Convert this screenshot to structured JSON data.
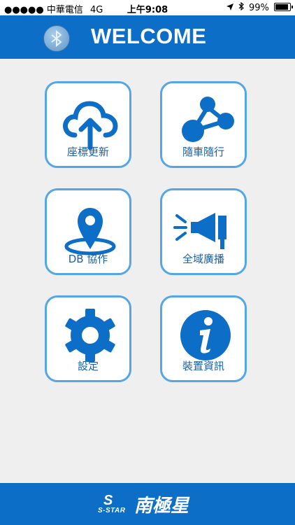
{
  "status_bar": {
    "carrier": "●●●●● 中華電信",
    "network": "4G",
    "time": "上午9:08",
    "location_icon": "location-arrow-icon",
    "bluetooth_icon": "bluetooth-icon",
    "battery": "99%"
  },
  "header": {
    "title": "WELCOME",
    "bluetooth_button_icon": "bluetooth-icon"
  },
  "tiles": [
    {
      "label": "座標更新",
      "icon": "cloud-upload-icon"
    },
    {
      "label": "隨車隨行",
      "icon": "share-nodes-icon"
    },
    {
      "label": "DB 協作",
      "icon": "map-pin-icon"
    },
    {
      "label": "全域廣播",
      "icon": "megaphone-icon"
    },
    {
      "label": "設定",
      "icon": "gear-icon"
    },
    {
      "label": "裝置資訊",
      "icon": "info-icon"
    }
  ],
  "footer": {
    "brand_mark": "S",
    "brand_en": "S-STAR",
    "brand_cn": "南極星"
  },
  "colors": {
    "primary_blue": "#0d6ec7",
    "tile_border": "#55a6e6",
    "background": "#efefef"
  }
}
